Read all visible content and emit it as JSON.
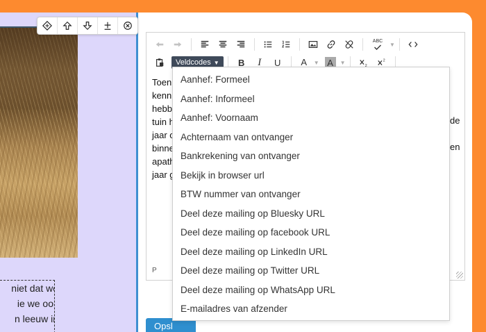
{
  "block_toolbar": {
    "icons": [
      "move-icon",
      "arrow-up-icon",
      "arrow-down-icon",
      "add-icon",
      "close-icon"
    ]
  },
  "left_text": [
    "niet dat we",
    "ie we ooit",
    "n leeuw in"
  ],
  "editor": {
    "veldcodes_label": "Veldcodes",
    "body_lines": [
      "Toen",
      "kenni",
      "hebbe",
      "tuin h",
      "jaar o",
      "binne",
      "apath",
      "jaar g"
    ],
    "right_fragments": [
      "de",
      "en"
    ],
    "status_path": "P",
    "toolbar_labels": {
      "bold": "B",
      "italic": "I",
      "underline": "U",
      "text_color": "A",
      "bg_color": "A",
      "spellcheck": "ABC"
    }
  },
  "dropdown": {
    "items": [
      "Aanhef: Formeel",
      "Aanhef: Informeel",
      "Aanhef: Voornaam",
      "Achternaam van ontvanger",
      "Bankrekening van ontvanger",
      "Bekijk in browser url",
      "BTW nummer van ontvanger",
      "Deel deze mailing op Bluesky URL",
      "Deel deze mailing op facebook URL",
      "Deel deze mailing op LinkedIn URL",
      "Deel deze mailing op Twitter URL",
      "Deel deze mailing op WhatsApp URL",
      "E-mailadres van afzender"
    ]
  },
  "save_button": {
    "label": "Opsl"
  },
  "colors": {
    "background": "#fd8a2f",
    "panel": "#ddd7fb",
    "accent": "#3e8fd1",
    "veldcodes_bg": "#3f4a5a"
  }
}
